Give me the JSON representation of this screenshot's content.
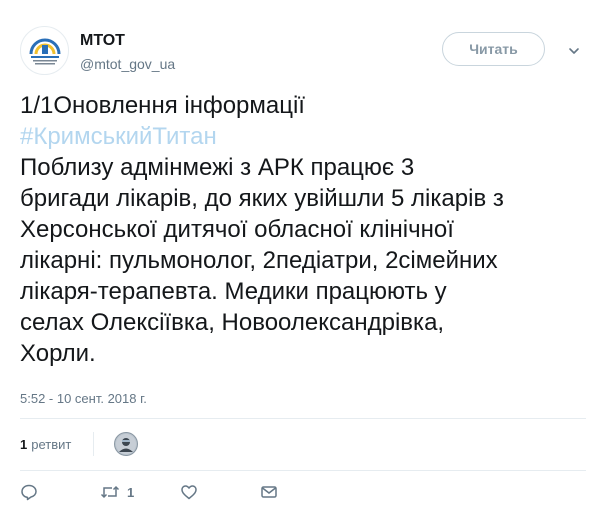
{
  "author": {
    "display_name": "МТОТ",
    "handle": "@mtot_gov_ua",
    "avatar_icon": "ministry-logo-icon"
  },
  "follow_button": {
    "label": "Читать"
  },
  "menu_icon": "chevron-down-icon",
  "tweet": {
    "lines": [
      "1/1Оновлення інформації",
      "#КримськийТитан",
      "Поблизу адмінмежі з АРК працює 3",
      "бригади лікарів, до яких увійшли 5 лікарів з",
      "Херсонської дитячої обласної клінічної",
      "лікарні: пульмонолог, 2педіатри, 2сімейних",
      "лікаря-терапевта. Медики працюють у",
      "селах Олексіївка, Новоолександрівка,",
      "Хорли."
    ],
    "hashtag_color": "#b3d6ef"
  },
  "timestamp": "5:52 - 10 сент. 2018 г.",
  "stats": {
    "retweet_count": "1",
    "retweet_label": "ретвит"
  },
  "actions": {
    "reply_icon": "reply-icon",
    "retweet_icon": "retweet-icon",
    "retweet_count": "1",
    "like_icon": "heart-icon",
    "dm_icon": "envelope-icon"
  },
  "colors": {
    "text": "#14171a",
    "secondary": "#657786",
    "border": "#e6ecf0"
  }
}
